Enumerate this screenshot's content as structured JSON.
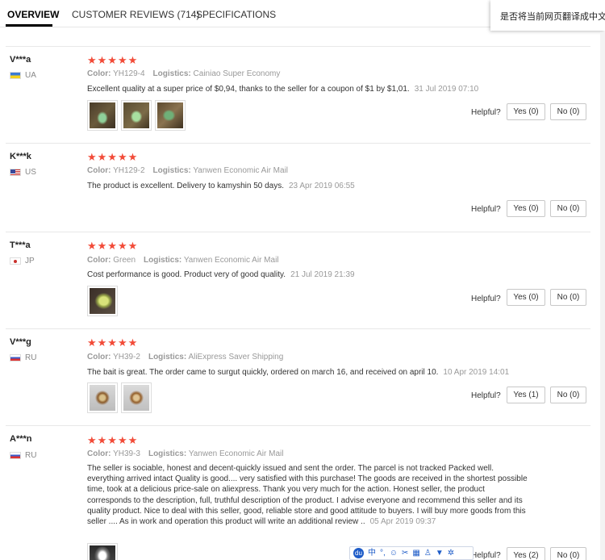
{
  "tabs": [
    {
      "label": "OVERVIEW",
      "active": true
    },
    {
      "label": "CUSTOMER REVIEWS (714)",
      "active": false
    },
    {
      "label": "SPECIFICATIONS",
      "active": false
    }
  ],
  "translate_popup": "是否将当前网页翻译成中文",
  "labels": {
    "color": "Color:",
    "logistics": "Logistics:",
    "helpful": "Helpful?"
  },
  "reviews": [
    {
      "user": "V***a",
      "country": "UA",
      "stars": "★★★★★",
      "rating": 5,
      "color": "YH129-4",
      "logistics": "Cainiao Super Economy",
      "text": "Excellent quality at a super price of $0,94, thanks to the seller for a coupon of $1 by $1,01.",
      "date": "31 Jul 2019 07:10",
      "yes": "Yes (0)",
      "no": "No (0)"
    },
    {
      "user": "K***k",
      "country": "US",
      "stars": "★★★★★",
      "rating": 5,
      "color": "YH129-2",
      "logistics": "Yanwen Economic Air Mail",
      "text": "The product is excellent. Delivery to kamyshin 50 days.",
      "date": "23 Apr 2019 06:55",
      "yes": "Yes (0)",
      "no": "No (0)"
    },
    {
      "user": "T***a",
      "country": "JP",
      "stars": "★★★★★",
      "rating": 5,
      "color": "Green",
      "logistics": "Yanwen Economic Air Mail",
      "text": "Cost performance is good. Product very of good quality.",
      "date": "21 Jul 2019 21:39",
      "yes": "Yes (0)",
      "no": "No (0)"
    },
    {
      "user": "V***g",
      "country": "RU",
      "stars": "★★★★★",
      "rating": 5,
      "color": "YH39-2",
      "logistics": "AliExpress Saver Shipping",
      "text": "The bait is great. The order came to surgut quickly, ordered on march 16, and received on april 10.",
      "date": "10 Apr 2019 14:01",
      "yes": "Yes (1)",
      "no": "No (0)"
    },
    {
      "user": "A***n",
      "country": "RU",
      "stars": "★★★★★",
      "rating": 5,
      "color": "YH39-3",
      "logistics": "Yanwen Economic Air Mail",
      "text": "The seller is sociable, honest and decent-quickly issued and sent the order. The parcel is not tracked Packed well. everything arrived intact Quality is good.... very satisfied with this purchase! The goods are received in the shortest possible time, took at a delicious price-sale on aliexpress. Thank you very much for the action. Honest seller, the product corresponds to the description, full, truthful description of the product. I advise everyone and recommend this seller and its quality product. Nice to deal with this seller, good, reliable store and good attitude to buyers. I will buy more goods from this seller .... As in work and operation this product will write an additional review ..",
      "date": "05 Apr 2019 09:37",
      "yes": "Yes (2)",
      "no": "No (0)"
    }
  ],
  "toolbar": {
    "icons": [
      "baidu-logo-icon",
      "chinese-input-icon",
      "punctuation-icon",
      "emoji-icon",
      "scissors-icon",
      "keyboard-icon",
      "user-icon",
      "shirt-icon",
      "settings-icon"
    ],
    "lang": "中"
  }
}
